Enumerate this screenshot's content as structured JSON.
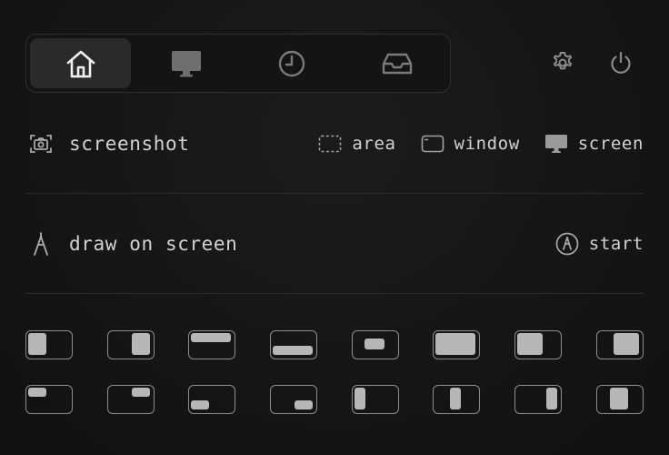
{
  "tabs": [
    {
      "id": "home",
      "icon": "home-icon",
      "active": true
    },
    {
      "id": "display",
      "icon": "display-icon",
      "active": false
    },
    {
      "id": "history",
      "icon": "clock-icon",
      "active": false
    },
    {
      "id": "inbox",
      "icon": "inbox-tray-icon",
      "active": false
    }
  ],
  "top_actions": [
    {
      "id": "settings",
      "icon": "gear-icon"
    },
    {
      "id": "quit",
      "icon": "power-icon"
    }
  ],
  "screenshot": {
    "label": "screenshot",
    "icon": "camera-icon",
    "actions": [
      {
        "label": "area",
        "icon": "dashed-rectangle-icon"
      },
      {
        "label": "window",
        "icon": "window-icon"
      },
      {
        "label": "screen",
        "icon": "monitor-icon"
      }
    ]
  },
  "draw": {
    "label": "draw on screen",
    "icon": "compass-pen-icon",
    "action_label": "start",
    "action_icon": "pen-circle-icon"
  },
  "window_layouts": [
    "left-half",
    "right-half",
    "top-half",
    "bottom-half",
    "center",
    "maximize",
    "left-two-thirds",
    "right-two-thirds",
    "top-left-quarter",
    "top-right-quarter",
    "bottom-left-quarter",
    "bottom-right-quarter",
    "left-third",
    "center-third",
    "right-third",
    "center-two-thirds"
  ],
  "colors": {
    "background": "#151515",
    "text": "#d2d2d2",
    "tab_active": "#2a2a2a",
    "cell_border": "#8d8d8d",
    "cell_fill": "#b7b7b7"
  }
}
